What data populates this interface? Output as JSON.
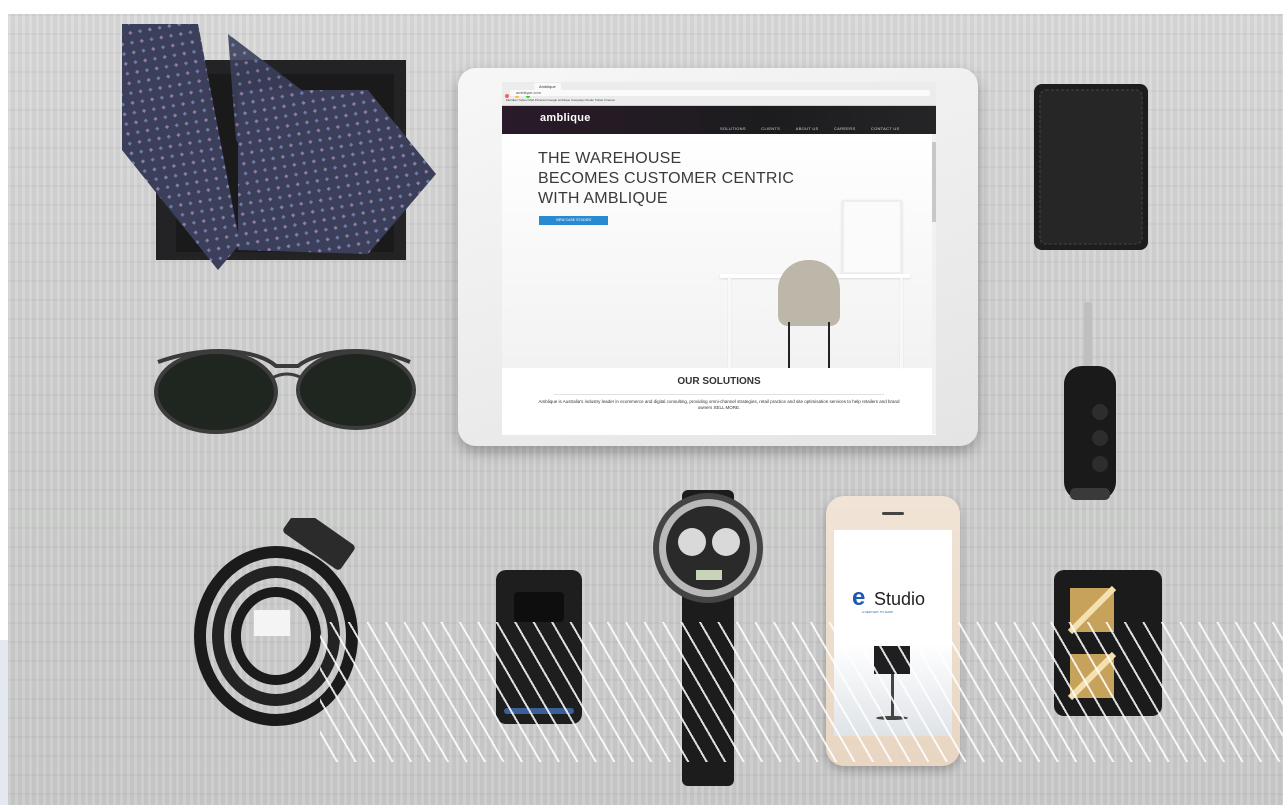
{
  "browser": {
    "tab_title": "Amblique",
    "url": "amblique.com",
    "bookmarks": "Meridian  Yahoo! Mail  Pinterest  Google  amblique  Campaign  Studio  Twitter  Finance"
  },
  "site": {
    "logo": "amblique",
    "nav": [
      "SOLUTIONS",
      "CLIENTS",
      "ABOUT US",
      "CAREERS",
      "CONTACT US"
    ],
    "headline": [
      "THE WAREHOUSE",
      "BECOMES CUSTOMER CENTRIC",
      "WITH AMBLIQUE"
    ],
    "cta": "VIEW CASE STUDIES",
    "solutions_title": "OUR SOLUTIONS",
    "solutions_text": "Amblique is Australia's industry leader in ecommerce and digital consulting, providing omni-channel strategies, retail practice and site optimisation services to help retailers and brand owners SELL MORE."
  },
  "phone": {
    "brand": "Studio",
    "tagline": "A NEW WAY TO SHOP"
  },
  "icons": {
    "tie_box": "tie-box-icon",
    "sunglasses": "sunglasses-icon",
    "wallet": "wallet-icon",
    "car_key": "car-key-icon",
    "belt": "belt-icon",
    "flip_phone": "flip-phone-icon",
    "watch": "wristwatch-icon",
    "cufflinks": "cufflinks-icon"
  },
  "colors": {
    "table": "#cfd0cf",
    "nav_bar": "#1f1f22",
    "cta": "#2a8ad1",
    "studio_blue": "#1e5ab0",
    "hatch": "#ffffff"
  }
}
